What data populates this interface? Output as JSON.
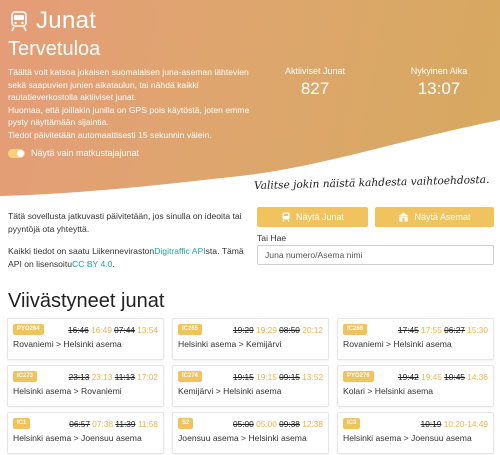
{
  "brand": {
    "title": "Junat",
    "icon": "train-icon"
  },
  "hero": {
    "welcome": "Tervetuloa",
    "intro": "Täältä voit katsoa jokaisen suomalaisen juna-aseman lähtevien sekä saapuvien junien aikataulun, tai nähdä kaikki rautatieverkostolla aktiiviset junat.\nHuomaa, että joillakin junilla on GPS pois käytöstä, joten emme pysty näyttämään sijaintia.\nTiedot päivitetään automaattisesti 15 sekunnin välein.",
    "toggle_label": "Näytä vain matkustajajunat",
    "toggle_on": true,
    "stats": [
      {
        "label": "Aktiiviset Junat",
        "value": "827"
      },
      {
        "label": "Nykyinen Aika",
        "value": "13:07"
      }
    ],
    "gradient": [
      "#e59c78",
      "#d7a95f"
    ]
  },
  "info": {
    "p1": "Tätä sovellusta jatkuvasti päivitetään, jos sinulla on ideoita tai pyyntöjä ota yhteyttä.",
    "p2a": "Kaikki tiedot on saatu Liikenneviraston",
    "p2link": "Digitraffic API",
    "p2b": "sta. Tämä API on lisensoitu",
    "p2license": "CC BY 4.0",
    "p2c": "."
  },
  "cta": "Valitse jokin näistä kahdesta vaihtoehdosta.",
  "buttons": {
    "trains": "Näytä Junat",
    "stations": "Näytä Asemat"
  },
  "search": {
    "label": "Tai Hae",
    "placeholder": "Juna numero/Asema nimi",
    "value": ""
  },
  "delayed": {
    "title": "Viivästyneet junat",
    "trains": [
      {
        "id": "PYO264",
        "t1": "16:46",
        "t2": "16:49",
        "t3": "07:44",
        "t4": "13:54",
        "route": "Rovaniemi > Helsinki asema"
      },
      {
        "id": "IC265",
        "t1": "19:29",
        "t2": "19:29",
        "t3": "08:50",
        "t4": "20:12",
        "route": "Helsinki asema > Kemijärvi"
      },
      {
        "id": "IC266",
        "t1": "17:45",
        "t2": "17:55",
        "t3": "06:27",
        "t4": "15:30",
        "route": "Rovaniemi > Helsinki asema"
      },
      {
        "id": "IC273",
        "t1": "23:13",
        "t2": "23:13",
        "t3": "11:13",
        "t4": "17:02",
        "route": "Helsinki asema > Rovaniemi"
      },
      {
        "id": "IC274",
        "t1": "19:15",
        "t2": "19:15",
        "t3": "09:15",
        "t4": "13:52",
        "route": "Kemijärvi > Helsinki asema"
      },
      {
        "id": "PYO276",
        "t1": "19:42",
        "t2": "19:45",
        "t3": "10:45",
        "t4": "14:36",
        "route": "Kolari > Helsinki asema"
      },
      {
        "id": "IC1",
        "t1": "06:57",
        "t2": "07:38",
        "t3": "11:39",
        "t4": "11:58",
        "route": "Helsinki asema > Joensuu asema"
      },
      {
        "id": "S2",
        "t1": "05:00",
        "t2": "05:00",
        "t3": "09:38",
        "t4": "12:38",
        "route": "Joensuu asema > Helsinki asema"
      },
      {
        "id": "IC3",
        "t1": "10:19",
        "t2": "",
        "t3": "",
        "t4": "10:20-14:49",
        "route": "Helsinki asema > Joensuu asema"
      }
    ]
  }
}
